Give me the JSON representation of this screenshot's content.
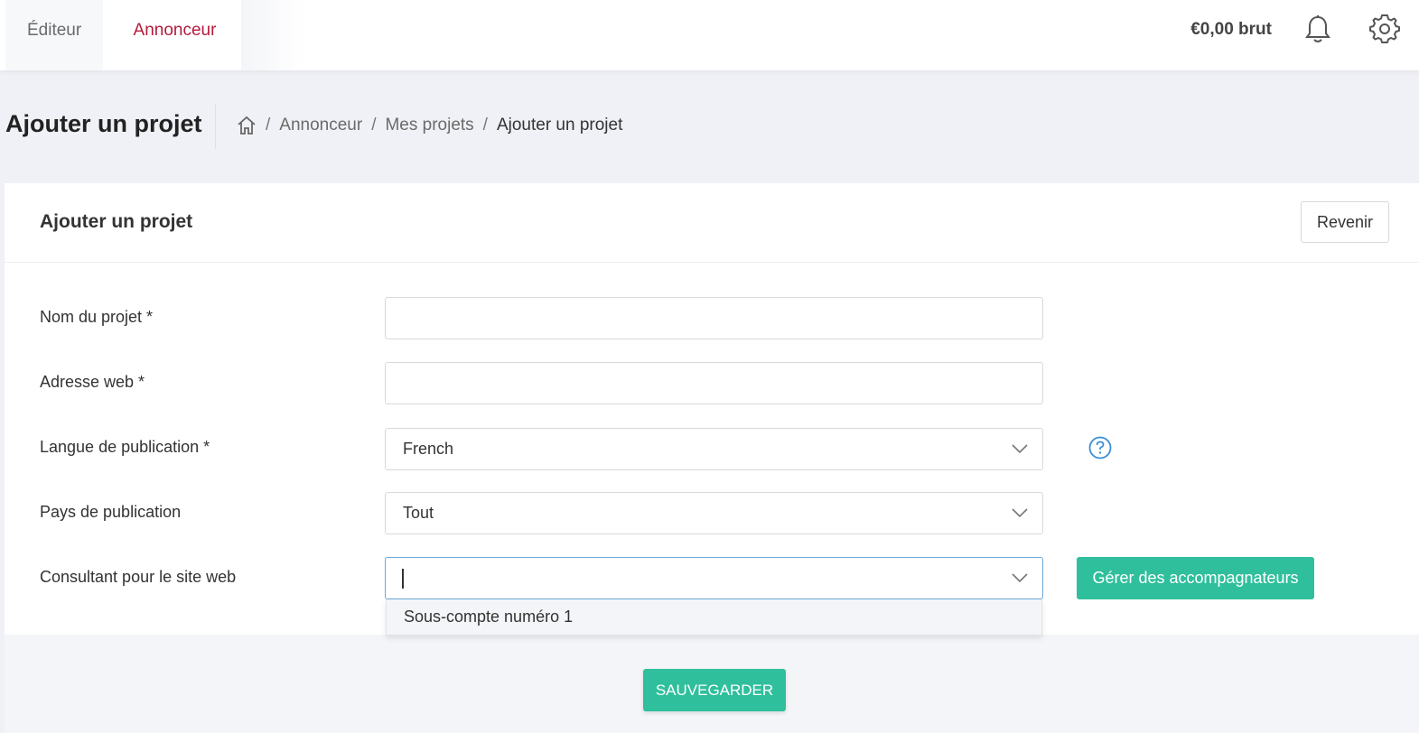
{
  "topbar": {
    "tabs": [
      {
        "label": "Éditeur",
        "active": false
      },
      {
        "label": "Annonceur",
        "active": true
      }
    ],
    "balance": "€0,00 brut",
    "icons": [
      "bell-icon",
      "gear-icon"
    ]
  },
  "page": {
    "title": "Ajouter un projet",
    "breadcrumb": [
      "Annonceur",
      "Mes projets",
      "Ajouter un projet"
    ]
  },
  "card": {
    "title": "Ajouter un projet",
    "back_label": "Revenir",
    "fields": {
      "name": {
        "label": "Nom du projet *",
        "value": ""
      },
      "web": {
        "label": "Adresse web *",
        "value": ""
      },
      "language": {
        "label": "Langue de publication *",
        "value": "French"
      },
      "country": {
        "label": "Pays de publication",
        "value": "Tout"
      },
      "consultant": {
        "label": "Consultant pour le site web",
        "value": ""
      }
    },
    "manage_label": "Gérer des accompagnateurs",
    "dropdown_options": [
      "Sous-compte numéro 1"
    ]
  },
  "footer": {
    "save_label": "SAUVEGARDER"
  },
  "colors": {
    "accent": "#2fbf9c",
    "active_tab": "#b31b3d",
    "focus": "#6aa7d8",
    "help": "#3a8fd6"
  }
}
